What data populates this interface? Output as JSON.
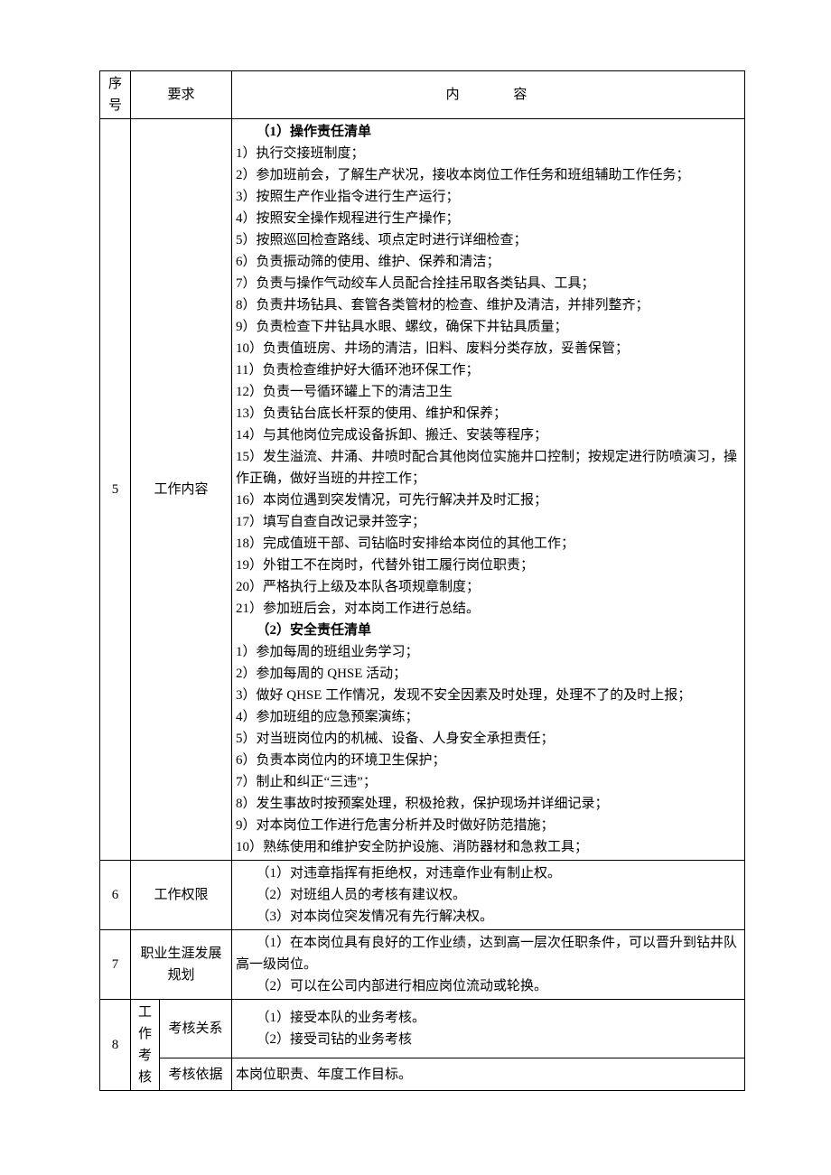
{
  "header": {
    "seq": "序号",
    "req": "要求",
    "content": "内 容"
  },
  "row5": {
    "seq": "5",
    "req": "工作内容",
    "op_title": "（1）操作责任清单",
    "op": [
      "1）执行交接班制度；",
      "2）参加班前会，了解生产状况，接收本岗位工作任务和班组辅助工作任务；",
      "3）按照生产作业指令进行生产运行；",
      "4）按照安全操作规程进行生产操作；",
      "5）按照巡回检查路线、项点定时进行详细检查；",
      "6）负责振动筛的使用、维护、保养和清洁；",
      "7）负责与操作气动绞车人员配合拴挂吊取各类钻具、工具；",
      "8）负责井场钻具、套管各类管材的检查、维护及清洁，并排列整齐；",
      "9）负责检查下井钻具水眼、螺纹，确保下井钻具质量；",
      "10）负责值班房、井场的清洁，旧料、废料分类存放，妥善保管；",
      "11）负责检查维护好大循环池环保工作；",
      "12）负责一号循环罐上下的清洁卫生",
      "13）负责钻台底长杆泵的使用、维护和保养；",
      "14）与其他岗位完成设备拆卸、搬迁、安装等程序；",
      "15）发生溢流、井涌、井喷时配合其他岗位实施井口控制；按规定进行防喷演习，操作正确，做好当班的井控工作；",
      "16）本岗位遇到突发情况，可先行解决并及时汇报；",
      "17）填写自查自改记录并签字；",
      "18）完成值班干部、司钻临时安排给本岗位的其他工作；",
      "19）外钳工不在岗时，代替外钳工履行岗位职责；",
      "20）严格执行上级及本队各项规章制度；",
      "21）参加班后会，对本岗工作进行总结。"
    ],
    "safe_title": "（2）安全责任清单",
    "safe": [
      "1）参加每周的班组业务学习；",
      "2）参加每周的 QHSE 活动；",
      "3）做好 QHSE 工作情况，发现不安全因素及时处理，处理不了的及时上报；",
      "4）参加班组的应急预案演练；",
      "5）对当班岗位内的机械、设备、人身安全承担责任；",
      "6）负责本岗位内的环境卫生保护；",
      "7）制止和纠正“三违”；",
      "8）发生事故时按预案处理，积极抢救，保护现场并详细记录；",
      "9）对本岗位工作进行危害分析并及时做好防范措施；",
      "10）熟练使用和维护安全防护设施、消防器材和急救工具；"
    ]
  },
  "row6": {
    "seq": "6",
    "req": "工作权限",
    "lines": [
      "（1）对违章指挥有拒绝权，对违章作业有制止权。",
      "（2）对班组人员的考核有建议权。",
      "（3）对本岗位突发情况有先行解决权。"
    ]
  },
  "row7": {
    "seq": "7",
    "req": "职业生涯发展规划",
    "lines": [
      "（1）在本岗位具有良好的工作业绩，达到高一层次任职条件，可以晋升到钻井队高一级岗位。",
      "（2）可以在公司内部进行相应岗位流动或轮换。"
    ]
  },
  "row8": {
    "seq": "8",
    "group": "工作考核",
    "r1": {
      "label": "考核关系",
      "lines": [
        "（1）接受本队的业务考核。",
        "（2）接受司钻的业务考核"
      ]
    },
    "r2": {
      "label": "考核依据",
      "content": "本岗位职责、年度工作目标。"
    }
  }
}
